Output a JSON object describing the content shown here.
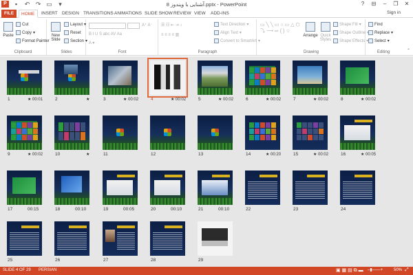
{
  "title_bar": {
    "title": "آشنایی با ویندوز 8.pptx - PowerPoint",
    "app_icon": "P",
    "help": "?",
    "minimize": "–",
    "restore": "❐",
    "close": "✕"
  },
  "tabs": [
    "FILE",
    "HOME",
    "INSERT",
    "DESIGN",
    "TRANSITIONS",
    "ANIMATIONS",
    "SLIDE SHOW",
    "REVIEW",
    "VIEW",
    "ADD-INS"
  ],
  "active_tab": "HOME",
  "sign_in": "Sign in",
  "ribbon": {
    "clipboard": {
      "label": "Clipboard",
      "paste": "Paste",
      "cut": "Cut",
      "copy": "Copy",
      "format_painter": "Format Painter"
    },
    "slides": {
      "label": "Slides",
      "new_slide": "New Slide",
      "layout": "Layout",
      "reset": "Reset",
      "section": "Section"
    },
    "font": {
      "label": "Font"
    },
    "paragraph": {
      "label": "Paragraph",
      "text_direction": "Text Direction",
      "align_text": "Align Text",
      "convert_smartart": "Convert to SmartArt"
    },
    "drawing": {
      "label": "Drawing",
      "arrange": "Arrange",
      "quick_styles": "Quick Styles",
      "shape_fill": "Shape Fill",
      "shape_outline": "Shape Outline",
      "shape_effects": "Shape Effects"
    },
    "editing": {
      "label": "Editing",
      "find": "Find",
      "replace": "Replace",
      "select": "Select"
    }
  },
  "slides": [
    {
      "num": "1",
      "time": "00:01",
      "star": true,
      "style": "title"
    },
    {
      "num": "2",
      "time": "",
      "star": true,
      "style": "logo-photo"
    },
    {
      "num": "3",
      "time": "00:02",
      "star": true,
      "style": "photo"
    },
    {
      "num": "4",
      "time": "00:02",
      "star": true,
      "style": "photo-bw",
      "selected": true
    },
    {
      "num": "5",
      "time": "00:02",
      "star": true,
      "style": "landscape"
    },
    {
      "num": "6",
      "time": "00:02",
      "star": true,
      "style": "green-tiles"
    },
    {
      "num": "7",
      "time": "00:02",
      "star": true,
      "style": "desktop"
    },
    {
      "num": "8",
      "time": "00:02",
      "star": true,
      "style": "green-screen"
    },
    {
      "num": "9",
      "time": "00:02",
      "star": true,
      "style": "green-tiles"
    },
    {
      "num": "10",
      "time": "",
      "star": true,
      "style": "tablet"
    },
    {
      "num": "11",
      "time": "",
      "star": false,
      "style": "logo"
    },
    {
      "num": "12",
      "time": "",
      "star": false,
      "style": "logo"
    },
    {
      "num": "13",
      "time": "",
      "star": false,
      "style": "logo"
    },
    {
      "num": "14",
      "time": "00:20",
      "star": true,
      "style": "tiles"
    },
    {
      "num": "15",
      "time": "00:02",
      "star": true,
      "style": "dark-tiles"
    },
    {
      "num": "16",
      "time": "00:05",
      "star": true,
      "style": "window"
    },
    {
      "num": "17",
      "time": "00:15",
      "star": false,
      "style": "green-screen"
    },
    {
      "num": "18",
      "time": "00:10",
      "star": false,
      "style": "monitor"
    },
    {
      "num": "19",
      "time": "00:05",
      "star": false,
      "style": "window"
    },
    {
      "num": "20",
      "time": "00:10",
      "star": false,
      "style": "window"
    },
    {
      "num": "21",
      "time": "00:10",
      "star": false,
      "style": "window-blue"
    },
    {
      "num": "22",
      "time": "",
      "star": false,
      "style": "text"
    },
    {
      "num": "23",
      "time": "",
      "star": false,
      "style": "text"
    },
    {
      "num": "24",
      "time": "",
      "star": false,
      "style": "text"
    },
    {
      "num": "25",
      "time": "",
      "star": false,
      "style": "text"
    },
    {
      "num": "26",
      "time": "",
      "star": false,
      "style": "text"
    },
    {
      "num": "27",
      "time": "",
      "star": false,
      "style": "text-person"
    },
    {
      "num": "28",
      "time": "",
      "star": false,
      "style": "text"
    },
    {
      "num": "29",
      "time": "",
      "star": false,
      "style": "laptop"
    }
  ],
  "status": {
    "slide_info": "SLIDE 4 OF 29",
    "language": "PERSIAN",
    "zoom": "50%"
  },
  "colors": {
    "accent": "#d24726",
    "sorter_bg": "#e6e6e6",
    "selection": "#e06a3b"
  }
}
